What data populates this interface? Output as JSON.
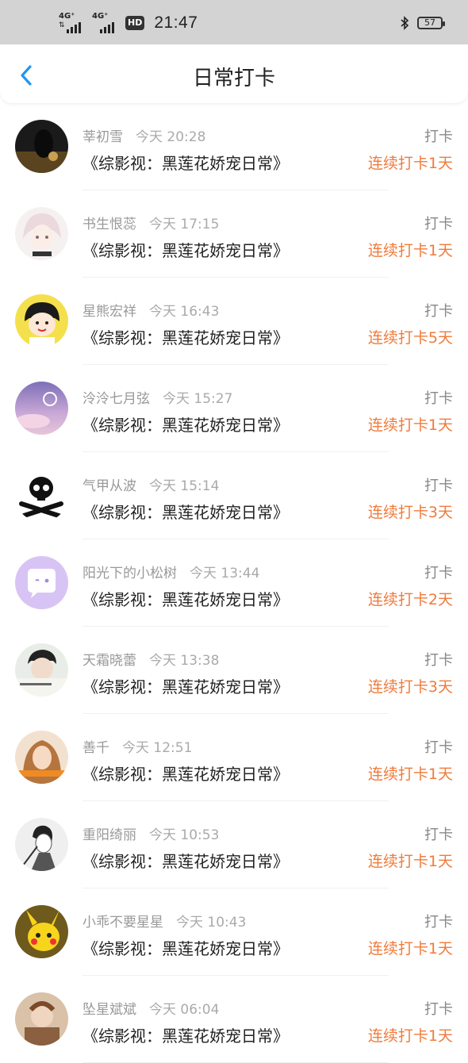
{
  "status_bar": {
    "net1": "4G⁺",
    "net2": "4G⁺",
    "hd": "HD",
    "time": "21:47",
    "battery": "57",
    "bluetooth_icon": "bluetooth-icon"
  },
  "header": {
    "title": "日常打卡",
    "back_icon": "chevron-left-icon"
  },
  "colors": {
    "accent": "#f07b3b",
    "back": "#2196f3"
  },
  "items": [
    {
      "name": "莘初雪",
      "time": "今天 20:28",
      "book": "《综影视：黑莲花娇宠日常》",
      "action": "打卡",
      "streak": "连续打卡1天"
    },
    {
      "name": "书生恨蕊",
      "time": "今天 17:15",
      "book": "《综影视：黑莲花娇宠日常》",
      "action": "打卡",
      "streak": "连续打卡1天"
    },
    {
      "name": "星熊宏祥",
      "time": "今天 16:43",
      "book": "《综影视：黑莲花娇宠日常》",
      "action": "打卡",
      "streak": "连续打卡5天"
    },
    {
      "name": "泠泠七月弦",
      "time": "今天 15:27",
      "book": "《综影视：黑莲花娇宠日常》",
      "action": "打卡",
      "streak": "连续打卡1天"
    },
    {
      "name": "气甲从波",
      "time": "今天 15:14",
      "book": "《综影视：黑莲花娇宠日常》",
      "action": "打卡",
      "streak": "连续打卡3天"
    },
    {
      "name": "阳光下的小松树",
      "time": "今天 13:44",
      "book": "《综影视：黑莲花娇宠日常》",
      "action": "打卡",
      "streak": "连续打卡2天"
    },
    {
      "name": "天霜晓蕾",
      "time": "今天 13:38",
      "book": "《综影视：黑莲花娇宠日常》",
      "action": "打卡",
      "streak": "连续打卡3天"
    },
    {
      "name": "善千",
      "time": "今天 12:51",
      "book": "《综影视：黑莲花娇宠日常》",
      "action": "打卡",
      "streak": "连续打卡1天"
    },
    {
      "name": "重阳绮丽",
      "time": "今天 10:53",
      "book": "《综影视：黑莲花娇宠日常》",
      "action": "打卡",
      "streak": "连续打卡1天"
    },
    {
      "name": "小乖不要星星",
      "time": "今天 10:43",
      "book": "《综影视：黑莲花娇宠日常》",
      "action": "打卡",
      "streak": "连续打卡1天"
    },
    {
      "name": "坠星斌斌",
      "time": "今天 06:04",
      "book": "《综影视：黑莲花娇宠日常》",
      "action": "打卡",
      "streak": "连续打卡1天"
    }
  ]
}
